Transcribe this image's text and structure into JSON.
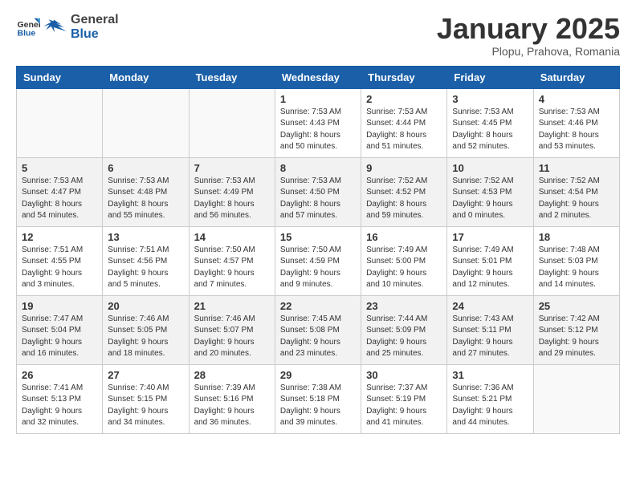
{
  "logo": {
    "general": "General",
    "blue": "Blue"
  },
  "title": "January 2025",
  "subtitle": "Plopu, Prahova, Romania",
  "headers": [
    "Sunday",
    "Monday",
    "Tuesday",
    "Wednesday",
    "Thursday",
    "Friday",
    "Saturday"
  ],
  "weeks": [
    [
      {
        "day": "",
        "info": ""
      },
      {
        "day": "",
        "info": ""
      },
      {
        "day": "",
        "info": ""
      },
      {
        "day": "1",
        "info": "Sunrise: 7:53 AM\nSunset: 4:43 PM\nDaylight: 8 hours\nand 50 minutes."
      },
      {
        "day": "2",
        "info": "Sunrise: 7:53 AM\nSunset: 4:44 PM\nDaylight: 8 hours\nand 51 minutes."
      },
      {
        "day": "3",
        "info": "Sunrise: 7:53 AM\nSunset: 4:45 PM\nDaylight: 8 hours\nand 52 minutes."
      },
      {
        "day": "4",
        "info": "Sunrise: 7:53 AM\nSunset: 4:46 PM\nDaylight: 8 hours\nand 53 minutes."
      }
    ],
    [
      {
        "day": "5",
        "info": "Sunrise: 7:53 AM\nSunset: 4:47 PM\nDaylight: 8 hours\nand 54 minutes."
      },
      {
        "day": "6",
        "info": "Sunrise: 7:53 AM\nSunset: 4:48 PM\nDaylight: 8 hours\nand 55 minutes."
      },
      {
        "day": "7",
        "info": "Sunrise: 7:53 AM\nSunset: 4:49 PM\nDaylight: 8 hours\nand 56 minutes."
      },
      {
        "day": "8",
        "info": "Sunrise: 7:53 AM\nSunset: 4:50 PM\nDaylight: 8 hours\nand 57 minutes."
      },
      {
        "day": "9",
        "info": "Sunrise: 7:52 AM\nSunset: 4:52 PM\nDaylight: 8 hours\nand 59 minutes."
      },
      {
        "day": "10",
        "info": "Sunrise: 7:52 AM\nSunset: 4:53 PM\nDaylight: 9 hours\nand 0 minutes."
      },
      {
        "day": "11",
        "info": "Sunrise: 7:52 AM\nSunset: 4:54 PM\nDaylight: 9 hours\nand 2 minutes."
      }
    ],
    [
      {
        "day": "12",
        "info": "Sunrise: 7:51 AM\nSunset: 4:55 PM\nDaylight: 9 hours\nand 3 minutes."
      },
      {
        "day": "13",
        "info": "Sunrise: 7:51 AM\nSunset: 4:56 PM\nDaylight: 9 hours\nand 5 minutes."
      },
      {
        "day": "14",
        "info": "Sunrise: 7:50 AM\nSunset: 4:57 PM\nDaylight: 9 hours\nand 7 minutes."
      },
      {
        "day": "15",
        "info": "Sunrise: 7:50 AM\nSunset: 4:59 PM\nDaylight: 9 hours\nand 9 minutes."
      },
      {
        "day": "16",
        "info": "Sunrise: 7:49 AM\nSunset: 5:00 PM\nDaylight: 9 hours\nand 10 minutes."
      },
      {
        "day": "17",
        "info": "Sunrise: 7:49 AM\nSunset: 5:01 PM\nDaylight: 9 hours\nand 12 minutes."
      },
      {
        "day": "18",
        "info": "Sunrise: 7:48 AM\nSunset: 5:03 PM\nDaylight: 9 hours\nand 14 minutes."
      }
    ],
    [
      {
        "day": "19",
        "info": "Sunrise: 7:47 AM\nSunset: 5:04 PM\nDaylight: 9 hours\nand 16 minutes."
      },
      {
        "day": "20",
        "info": "Sunrise: 7:46 AM\nSunset: 5:05 PM\nDaylight: 9 hours\nand 18 minutes."
      },
      {
        "day": "21",
        "info": "Sunrise: 7:46 AM\nSunset: 5:07 PM\nDaylight: 9 hours\nand 20 minutes."
      },
      {
        "day": "22",
        "info": "Sunrise: 7:45 AM\nSunset: 5:08 PM\nDaylight: 9 hours\nand 23 minutes."
      },
      {
        "day": "23",
        "info": "Sunrise: 7:44 AM\nSunset: 5:09 PM\nDaylight: 9 hours\nand 25 minutes."
      },
      {
        "day": "24",
        "info": "Sunrise: 7:43 AM\nSunset: 5:11 PM\nDaylight: 9 hours\nand 27 minutes."
      },
      {
        "day": "25",
        "info": "Sunrise: 7:42 AM\nSunset: 5:12 PM\nDaylight: 9 hours\nand 29 minutes."
      }
    ],
    [
      {
        "day": "26",
        "info": "Sunrise: 7:41 AM\nSunset: 5:13 PM\nDaylight: 9 hours\nand 32 minutes."
      },
      {
        "day": "27",
        "info": "Sunrise: 7:40 AM\nSunset: 5:15 PM\nDaylight: 9 hours\nand 34 minutes."
      },
      {
        "day": "28",
        "info": "Sunrise: 7:39 AM\nSunset: 5:16 PM\nDaylight: 9 hours\nand 36 minutes."
      },
      {
        "day": "29",
        "info": "Sunrise: 7:38 AM\nSunset: 5:18 PM\nDaylight: 9 hours\nand 39 minutes."
      },
      {
        "day": "30",
        "info": "Sunrise: 7:37 AM\nSunset: 5:19 PM\nDaylight: 9 hours\nand 41 minutes."
      },
      {
        "day": "31",
        "info": "Sunrise: 7:36 AM\nSunset: 5:21 PM\nDaylight: 9 hours\nand 44 minutes."
      },
      {
        "day": "",
        "info": ""
      }
    ]
  ]
}
